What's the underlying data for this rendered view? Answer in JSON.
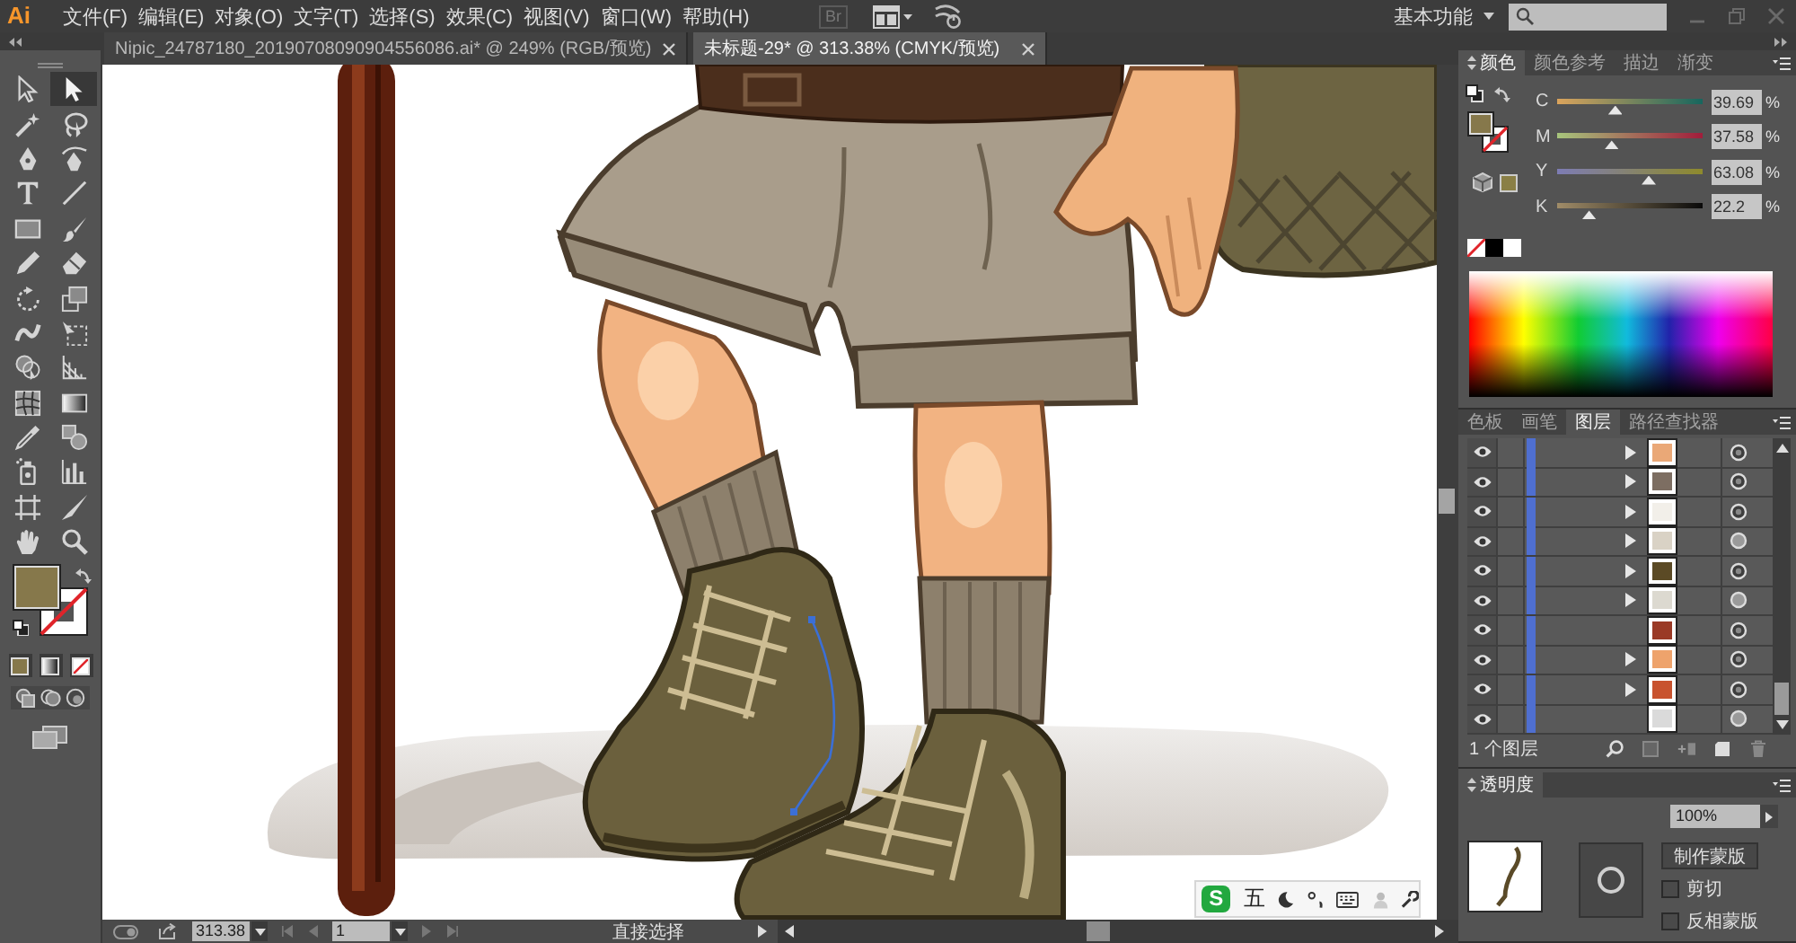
{
  "menu_bar": {
    "logo": "Ai",
    "menus": [
      "文件(F)",
      "编辑(E)",
      "对象(O)",
      "文字(T)",
      "选择(S)",
      "效果(C)",
      "视图(V)",
      "窗口(W)",
      "帮助(H)"
    ],
    "bridge_label": "Br",
    "workspace": "基本功能"
  },
  "document_tabs": [
    {
      "title": "Nipic_24787180_20190708090904556086.ai* @ 249% (RGB/预览)",
      "selected": false
    },
    {
      "title": "未标题-29* @ 313.38% (CMYK/预览)",
      "selected": true
    }
  ],
  "toolbar": {
    "tools": [
      {
        "selected": false
      },
      {
        "selected": true
      },
      {
        "selected": false
      },
      {
        "selected": false
      },
      {
        "selected": false
      },
      {
        "selected": false
      },
      {
        "selected": false
      },
      {
        "selected": false
      },
      {
        "selected": false
      },
      {
        "selected": false
      },
      {
        "selected": false
      },
      {
        "selected": false
      },
      {
        "selected": false
      },
      {
        "selected": false
      },
      {
        "selected": false
      },
      {
        "selected": false
      },
      {
        "selected": false
      },
      {
        "selected": false
      },
      {
        "selected": false
      },
      {
        "selected": false
      },
      {
        "selected": false
      },
      {
        "selected": false
      },
      {
        "selected": false
      },
      {
        "selected": false
      },
      {
        "selected": false
      },
      {
        "selected": false
      },
      {
        "selected": false
      },
      {
        "selected": false
      }
    ],
    "swatches": [
      {
        "kind": "fill",
        "color": "#86784b"
      },
      {
        "kind": "stroke",
        "none": true
      }
    ]
  },
  "color_panel": {
    "tabs": [
      {
        "label": "颜色",
        "selected": true
      },
      {
        "label": "颜色参考",
        "selected": false
      },
      {
        "label": "描边",
        "selected": false
      },
      {
        "label": "渐变",
        "selected": false
      }
    ],
    "swatches": [
      {
        "kind": "fill",
        "color": "#86784b"
      },
      {
        "kind": "stroke",
        "none": true
      },
      {
        "kind": "web",
        "color": "#8a7f46"
      }
    ],
    "channels": [
      {
        "name": "C",
        "level": 0.4,
        "value": "39.69",
        "unit": "%"
      },
      {
        "name": "M",
        "level": 0.375,
        "value": "37.58",
        "unit": "%"
      },
      {
        "name": "Y",
        "level": 0.63,
        "value": "63.08",
        "unit": "%"
      },
      {
        "name": "K",
        "level": 0.22,
        "value": "22.2",
        "unit": "%"
      }
    ]
  },
  "layers_panel": {
    "tabs": [
      {
        "label": "色板",
        "selected": false
      },
      {
        "label": "画笔",
        "selected": false
      },
      {
        "label": "图层",
        "selected": true
      },
      {
        "label": "路径查找器",
        "selected": false
      }
    ],
    "layers": [
      {
        "visible": true,
        "expandable": true,
        "color": "#eaa877",
        "appearance": false
      },
      {
        "visible": true,
        "expandable": true,
        "color": "#7d6e62",
        "appearance": false
      },
      {
        "visible": true,
        "expandable": true,
        "color": "#f2efe9",
        "appearance": false
      },
      {
        "visible": true,
        "expandable": true,
        "color": "#d9d2c5",
        "appearance": true
      },
      {
        "visible": true,
        "expandable": true,
        "color": "#5b4a25",
        "appearance": false
      },
      {
        "visible": true,
        "expandable": true,
        "color": "#dcd9d0",
        "appearance": true
      },
      {
        "visible": true,
        "expandable": false,
        "color": "#9a3a26",
        "appearance": false
      },
      {
        "visible": true,
        "expandable": true,
        "color": "#eea36c",
        "appearance": false
      },
      {
        "visible": true,
        "expandable": true,
        "color": "#c8532f",
        "appearance": false
      },
      {
        "visible": true,
        "expandable": false,
        "color": "#dadada",
        "appearance": true
      }
    ],
    "count": "1 个图层"
  },
  "transparency_panel": {
    "title": "透明度",
    "opacity": "100%",
    "mask_button": "制作蒙版",
    "options": [
      {
        "label": "剪切",
        "checked": false
      },
      {
        "label": "反相蒙版",
        "checked": false
      }
    ]
  },
  "ime_toolbar": {
    "logo": "S",
    "mode": "五"
  },
  "status_bar": {
    "zoom": "313.38",
    "artboard": "1",
    "tool": "直接选择"
  }
}
